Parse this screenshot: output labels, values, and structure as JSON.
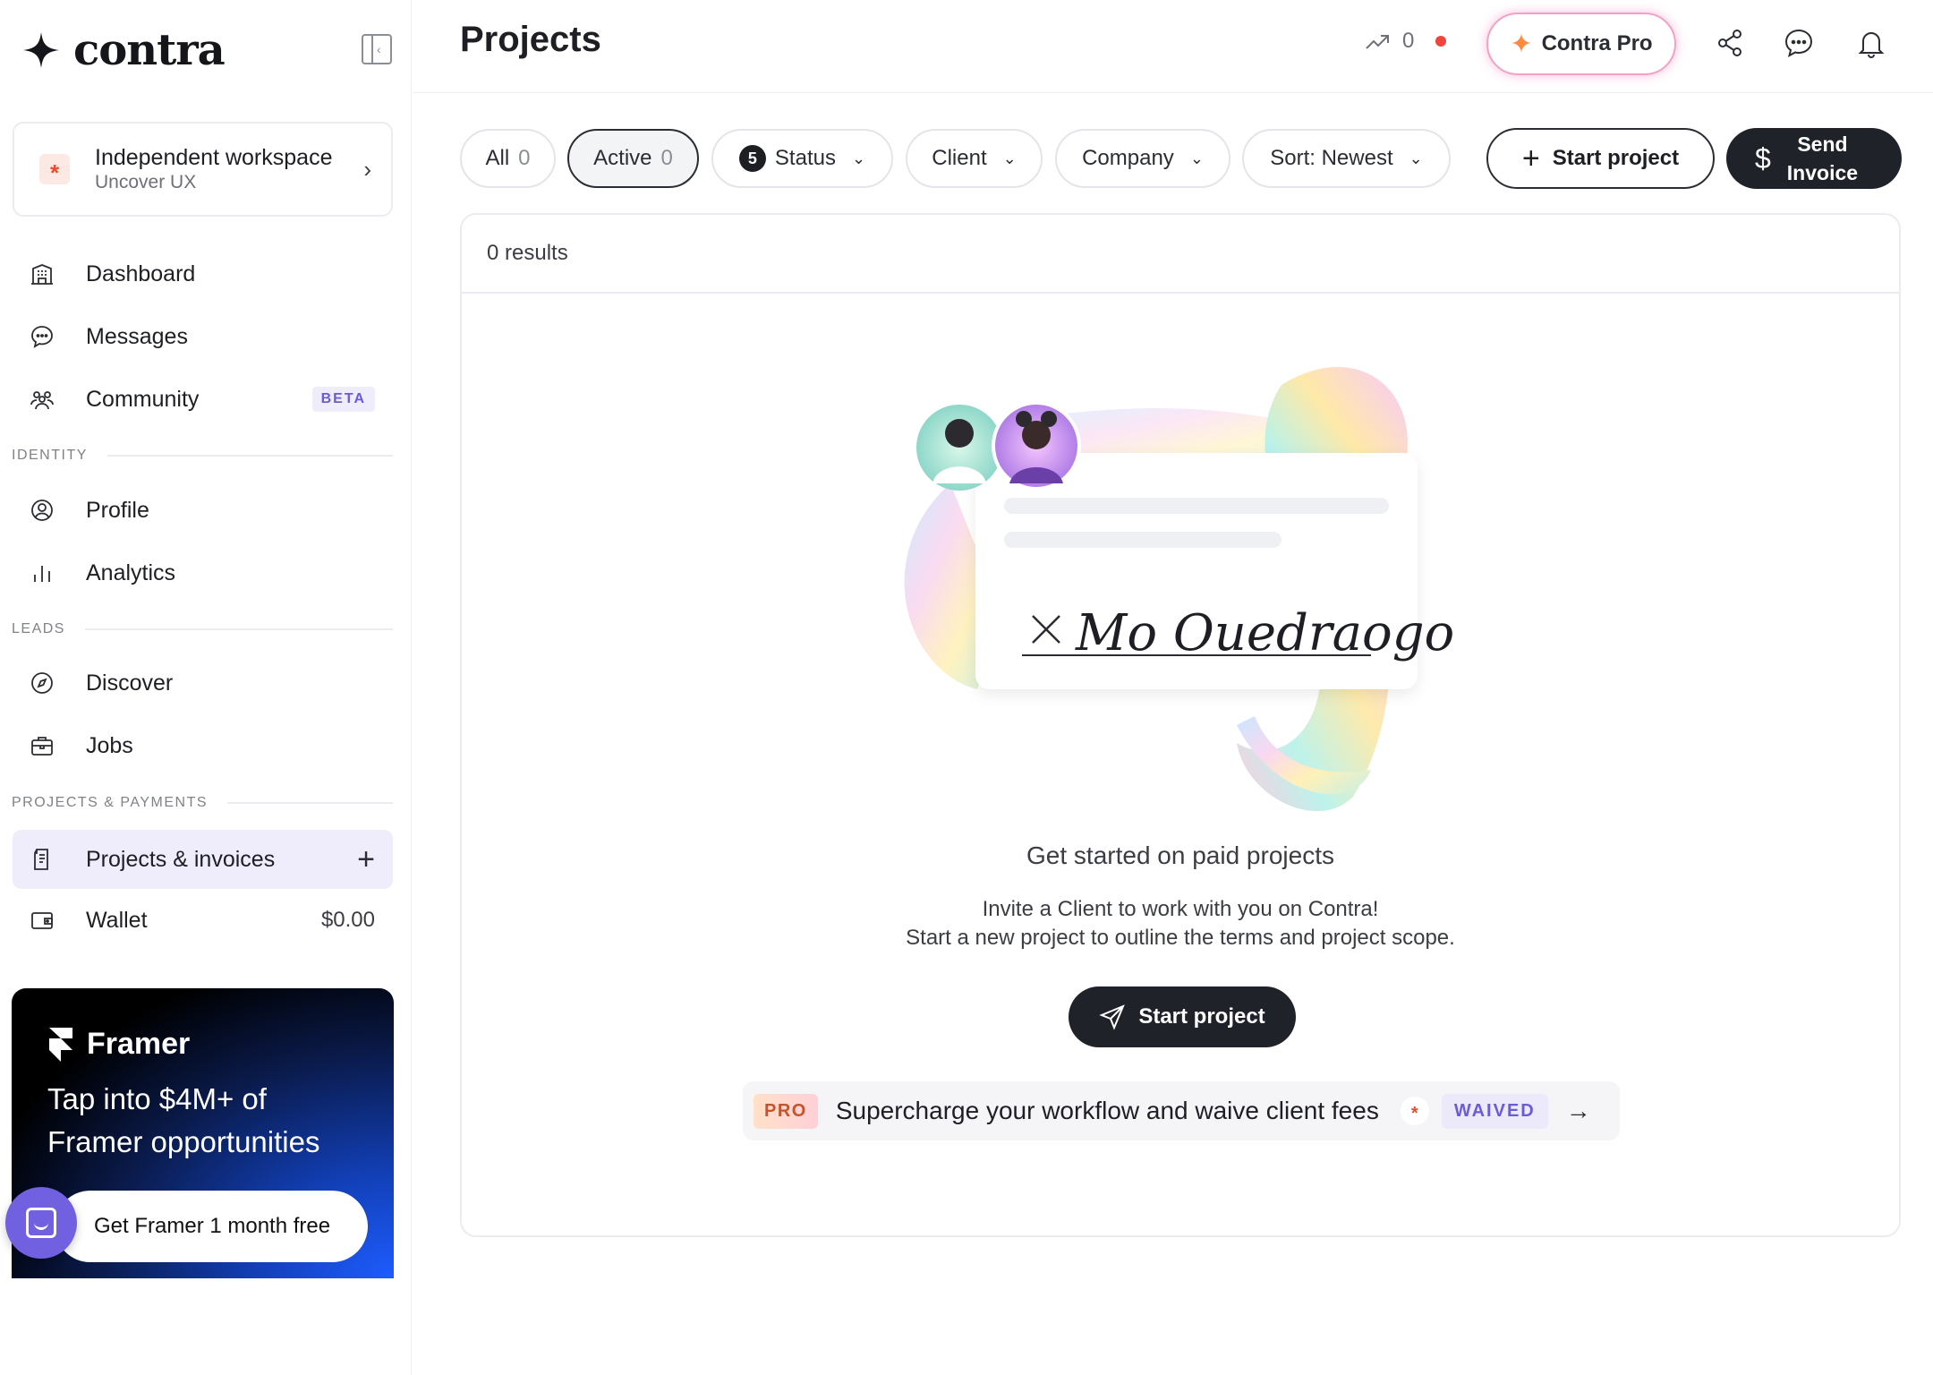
{
  "brand": {
    "name": "contra"
  },
  "workspace": {
    "title": "Independent workspace",
    "subtitle": "Uncover UX",
    "avatar": "*"
  },
  "nav": {
    "dashboard": "Dashboard",
    "messages": "Messages",
    "community": "Community",
    "community_badge": "BETA",
    "section_identity": "IDENTITY",
    "profile": "Profile",
    "analytics": "Analytics",
    "section_leads": "LEADS",
    "discover": "Discover",
    "jobs": "Jobs",
    "section_projects": "PROJECTS & PAYMENTS",
    "projects": "Projects & invoices",
    "wallet": "Wallet",
    "wallet_balance": "$0.00"
  },
  "promo": {
    "brand": "Framer",
    "title": "Tap into $4M+ of Framer opportunities",
    "cta": "Get Framer 1 month free"
  },
  "header": {
    "title": "Projects",
    "trend_count": "0",
    "pro_label": "Contra Pro"
  },
  "filters": {
    "all_label": "All",
    "all_count": "0",
    "active_label": "Active",
    "active_count": "0",
    "status_badge": "5",
    "status_label": "Status",
    "client_label": "Client",
    "company_label": "Company",
    "sort_label": "Sort: Newest",
    "start_project": "Start project",
    "send_invoice_line1": "Send",
    "send_invoice_line2": "Invoice"
  },
  "results": {
    "count_text": "0 results",
    "signature": "Mo Ouedraogo",
    "empty_title": "Get started on paid projects",
    "empty_desc_line1": "Invite a Client to work with you on Contra!",
    "empty_desc_line2": "Start a new project to outline the terms and project scope.",
    "start_button": "Start project",
    "pro_tag": "PRO",
    "pro_text": "Supercharge your workflow and waive client fees",
    "pro_star": "*",
    "waived_label": "WAIVED"
  },
  "colors": {
    "accent_purple": "#6a5bd6",
    "dark_button": "#1f2228",
    "notification_red": "#f0453a",
    "brand_orange": "#f04a2b"
  }
}
